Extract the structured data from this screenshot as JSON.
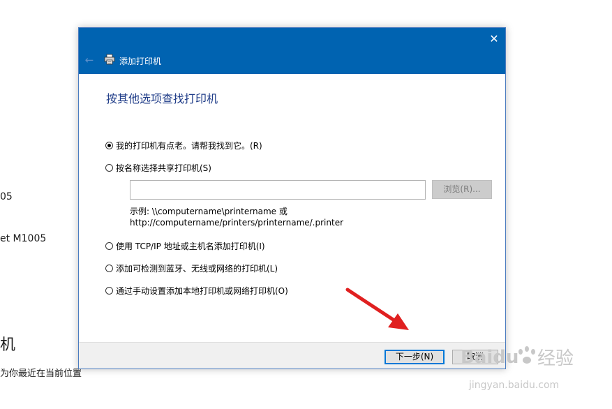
{
  "background": {
    "line1": "05",
    "line2": "et M1005",
    "line3": "机",
    "line4": "为你最近在当前位置"
  },
  "dialog": {
    "title": "添加打印机",
    "close_icon": "close-icon",
    "back_icon": "back-arrow-icon",
    "heading": "按其他选项查找打印机",
    "options": [
      {
        "label": "我的打印机有点老。请帮我找到它。(R)",
        "checked": true
      },
      {
        "label": "按名称选择共享打印机(S)",
        "checked": false
      },
      {
        "label": "使用 TCP/IP 地址或主机名添加打印机(I)",
        "checked": false
      },
      {
        "label": "添加可检测到蓝牙、无线或网络的打印机(L)",
        "checked": false
      },
      {
        "label": "通过手动设置添加本地打印机或网络打印机(O)",
        "checked": false
      }
    ],
    "share_input_value": "",
    "browse_label": "浏览(R)...",
    "example_line1": "示例: \\\\computername\\printername 或",
    "example_line2": "http://computername/printers/printername/.printer",
    "next_label": "下一步(N)",
    "cancel_label": "取消"
  },
  "colors": {
    "titlebar": "#0063b1",
    "heading": "#1f3c88",
    "arrow": "#e02020"
  },
  "watermark": {
    "brand": "Baidu",
    "brand_cn": "经验",
    "url": "jingyan.baidu.com"
  }
}
